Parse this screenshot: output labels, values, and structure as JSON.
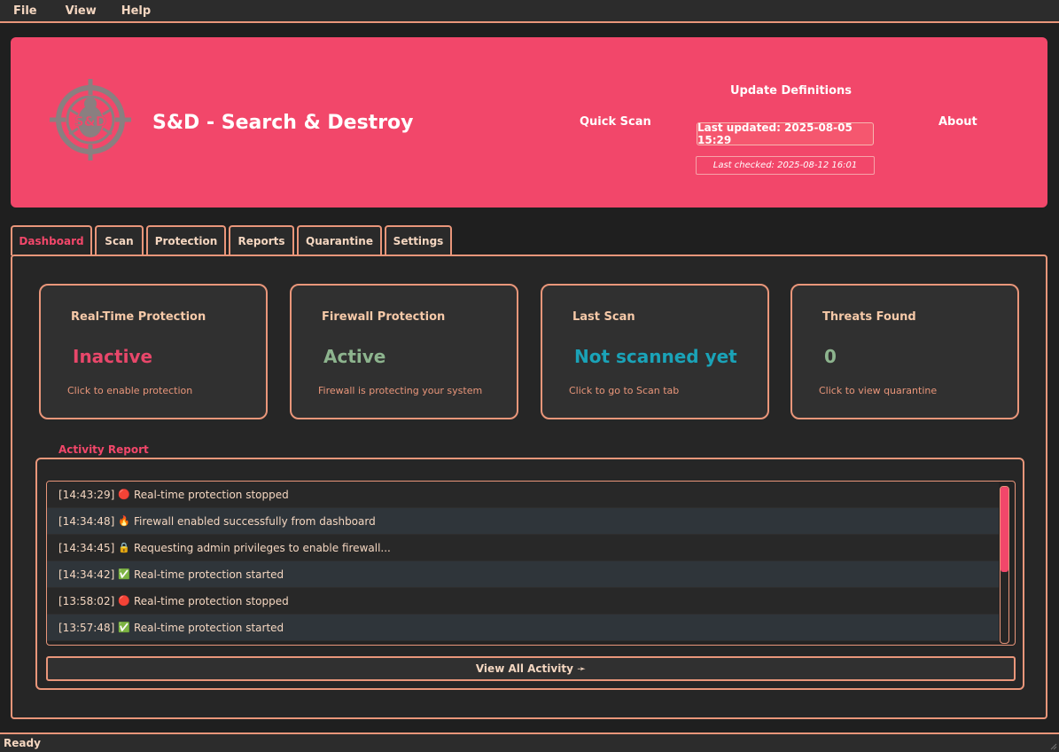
{
  "menu": [
    "File",
    "View",
    "Help"
  ],
  "header": {
    "title": "S&D - Search & Destroy",
    "logo_text": "S&D",
    "quick_scan": "Quick Scan",
    "update_definitions": "Update Definitions",
    "last_updated": "Last updated: 2025-08-05 15:29",
    "last_checked": "Last checked: 2025-08-12 16:01",
    "about": "About"
  },
  "tabs": [
    "Dashboard",
    "Scan",
    "Protection",
    "Reports",
    "Quarantine",
    "Settings"
  ],
  "active_tab": "Dashboard",
  "cards": [
    {
      "title": "Real-Time Protection",
      "value": "Inactive",
      "hint": "Click to enable protection",
      "color": "#e8476a"
    },
    {
      "title": "Firewall Protection",
      "value": "Active",
      "hint": "Firewall is protecting your system",
      "color": "#8db48e"
    },
    {
      "title": "Last Scan",
      "value": "Not scanned yet",
      "hint": "Click to go to Scan tab",
      "color": "#1aa3b8"
    },
    {
      "title": "Threats Found",
      "value": "0",
      "hint": "Click to view quarantine",
      "color": "#8db48e"
    }
  ],
  "activity": {
    "label": "Activity Report",
    "rows": [
      {
        "time": "[14:43:29]",
        "icon": "red-circle-icon",
        "glyph": "🔴",
        "text": "Real-time protection stopped"
      },
      {
        "time": "[14:34:48]",
        "icon": "fire-icon",
        "glyph": "🔥",
        "text": "Firewall enabled successfully from dashboard"
      },
      {
        "time": "[14:34:45]",
        "icon": "lock-icon",
        "glyph": "🔒",
        "text": "Requesting admin privileges to enable firewall..."
      },
      {
        "time": "[14:34:42]",
        "icon": "check-icon",
        "glyph": "✅",
        "text": "Real-time protection started"
      },
      {
        "time": "[13:58:02]",
        "icon": "red-circle-icon",
        "glyph": "🔴",
        "text": "Real-time protection stopped"
      },
      {
        "time": "[13:57:48]",
        "icon": "check-icon",
        "glyph": "✅",
        "text": "Real-time protection started"
      }
    ],
    "view_all": "View All Activity ➛"
  },
  "status": "Ready",
  "colors": {
    "accent": "#f2476a",
    "border": "#e9967a",
    "background": "#1f1f1f"
  }
}
